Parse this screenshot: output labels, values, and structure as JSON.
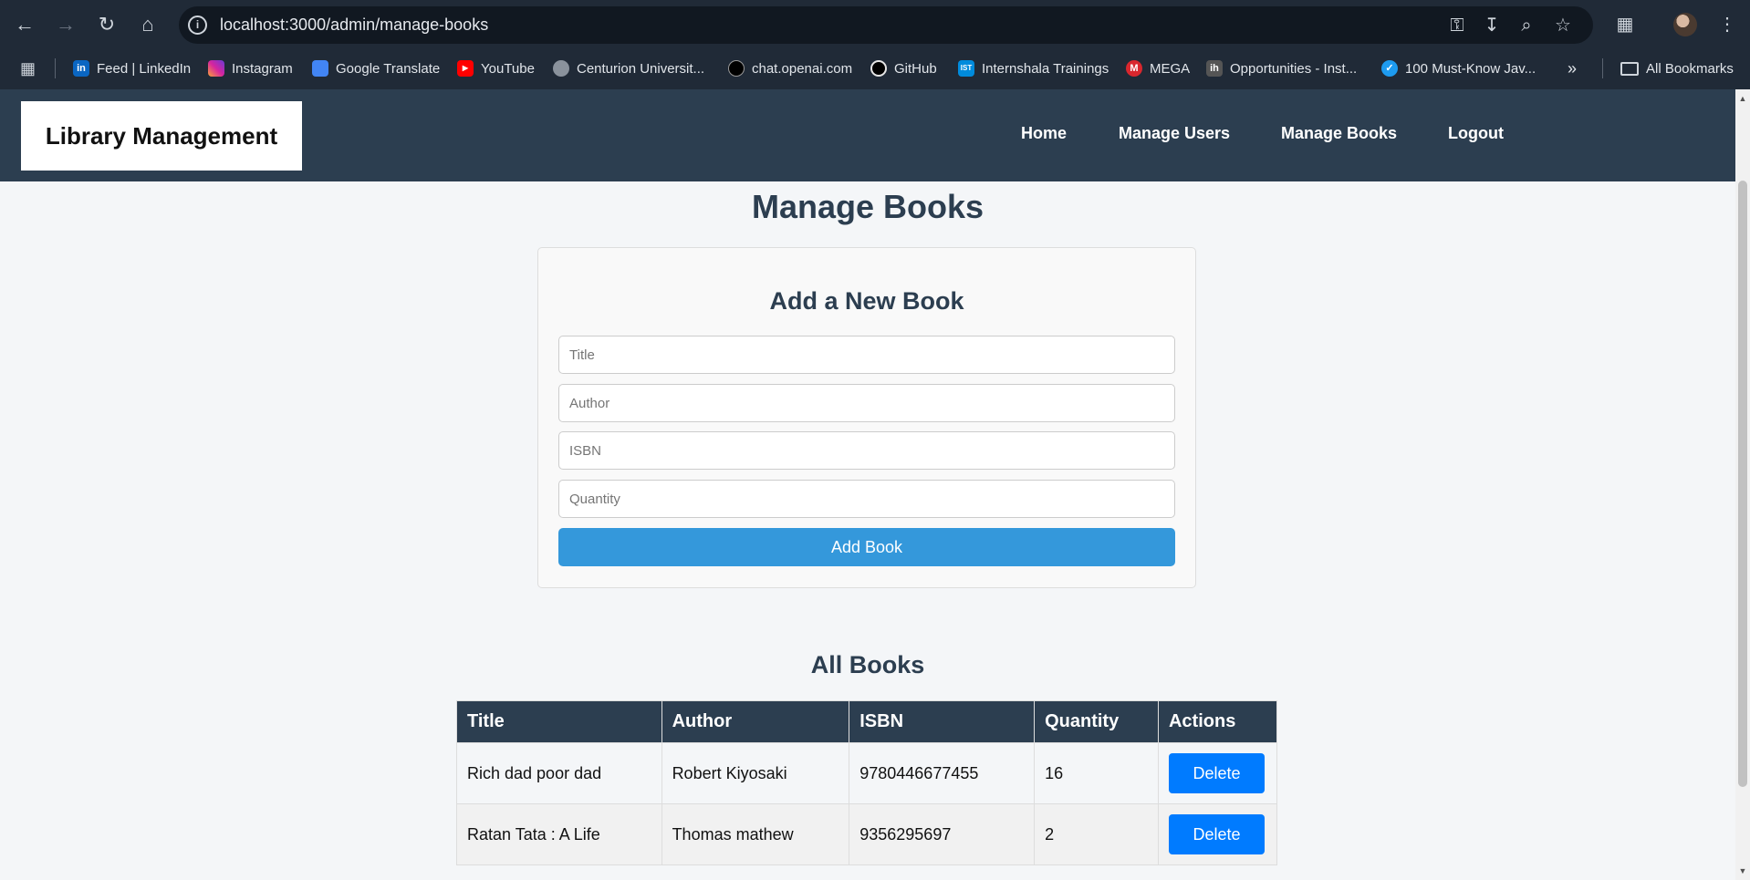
{
  "browser": {
    "url": "localhost:3000/admin/manage-books",
    "bookmarks": [
      {
        "label": "Feed | LinkedIn",
        "icon": "linkedin-icon",
        "color": "#0a66c2"
      },
      {
        "label": "Instagram",
        "icon": "instagram-icon",
        "color": "#d6249f"
      },
      {
        "label": "Google Translate",
        "icon": "google-translate-icon",
        "color": "#4285f4"
      },
      {
        "label": "YouTube",
        "icon": "youtube-icon",
        "color": "#ff0000"
      },
      {
        "label": "Centurion Universit...",
        "icon": "globe-icon",
        "color": "#8a929c"
      },
      {
        "label": "chat.openai.com",
        "icon": "openai-icon",
        "color": "#000000"
      },
      {
        "label": "GitHub",
        "icon": "github-icon",
        "color": "#000000"
      },
      {
        "label": "Internshala Trainings",
        "icon": "internshala-icon",
        "color": "#008bdc"
      },
      {
        "label": "MEGA",
        "icon": "mega-icon",
        "color": "#d9272e"
      },
      {
        "label": "Opportunities - Inst...",
        "icon": "internshala-ih-icon",
        "color": "#555555"
      },
      {
        "label": "100 Must-Know Jav...",
        "icon": "check-badge-icon",
        "color": "#1d9bf0"
      }
    ],
    "all_bookmarks_label": "All Bookmarks",
    "bookmark_glyphs": {
      "linkedin": "in",
      "internshala": "IST",
      "internshala_ih": "ih",
      "mega": "M"
    }
  },
  "header": {
    "brand": "Library Management",
    "nav": [
      "Home",
      "Manage Users",
      "Manage Books",
      "Logout"
    ]
  },
  "page_title": "Manage Books",
  "form": {
    "title": "Add a New Book",
    "fields": [
      {
        "placeholder": "Title",
        "value": ""
      },
      {
        "placeholder": "Author",
        "value": ""
      },
      {
        "placeholder": "ISBN",
        "value": ""
      },
      {
        "placeholder": "Quantity",
        "value": ""
      }
    ],
    "submit_label": "Add Book"
  },
  "books": {
    "title": "All Books",
    "columns": [
      "Title",
      "Author",
      "ISBN",
      "Quantity",
      "Actions"
    ],
    "rows": [
      {
        "title": "Rich dad poor dad",
        "author": "Robert Kiyosaki",
        "isbn": "9780446677455",
        "quantity": "16",
        "action": "Delete"
      },
      {
        "title": "Ratan Tata : A Life",
        "author": "Thomas mathew",
        "isbn": "9356295697",
        "quantity": "2",
        "action": "Delete"
      }
    ]
  },
  "colors": {
    "header_bg": "#2c3e50",
    "primary_button": "#3498db",
    "delete_button": "#007bff"
  }
}
